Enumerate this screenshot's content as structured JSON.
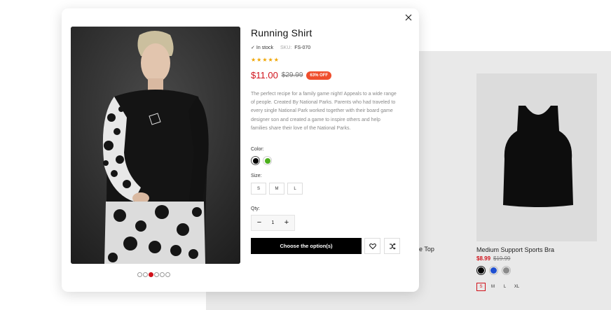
{
  "product": {
    "title": "Running Shirt",
    "stock": "In stock",
    "sku_label": "SKU:",
    "sku": "FS-070",
    "stars": "★★★★★",
    "price": "$11.00",
    "old_price": "$29.99",
    "discount": "63% OFF",
    "description": "The perfect recipe for a family game night! Appeals to a wide range of people. Created By National Parks. Parents who had traveled to every single National Park worked together with their board game designer son and created a game to inspire others and help families share their love of the National Parks.",
    "color_label": "Color:",
    "colors": [
      "#000000",
      "#4caf1c"
    ],
    "size_label": "Size:",
    "sizes": [
      "S",
      "M",
      "L"
    ],
    "qty_label": "Qty:",
    "qty": "1",
    "minus": "−",
    "plus": "+",
    "cta": "Choose the option(s)",
    "gallery_count": 6,
    "gallery_active": 2
  },
  "background": {
    "card1_title": "le Top",
    "card2_title": "Medium Support Sports Bra",
    "card2_price": "$8.99",
    "card2_old_price": "$19.99",
    "card2_colors": [
      "#000000",
      "#1f4fd1",
      "#8a8a8a"
    ],
    "card2_sizes": [
      "S",
      "M",
      "L",
      "XL"
    ]
  },
  "icons": {
    "close": "close-icon",
    "wishlist": "heart-icon",
    "compare": "shuffle-icon",
    "check": "check-icon",
    "star": "star-icon"
  }
}
